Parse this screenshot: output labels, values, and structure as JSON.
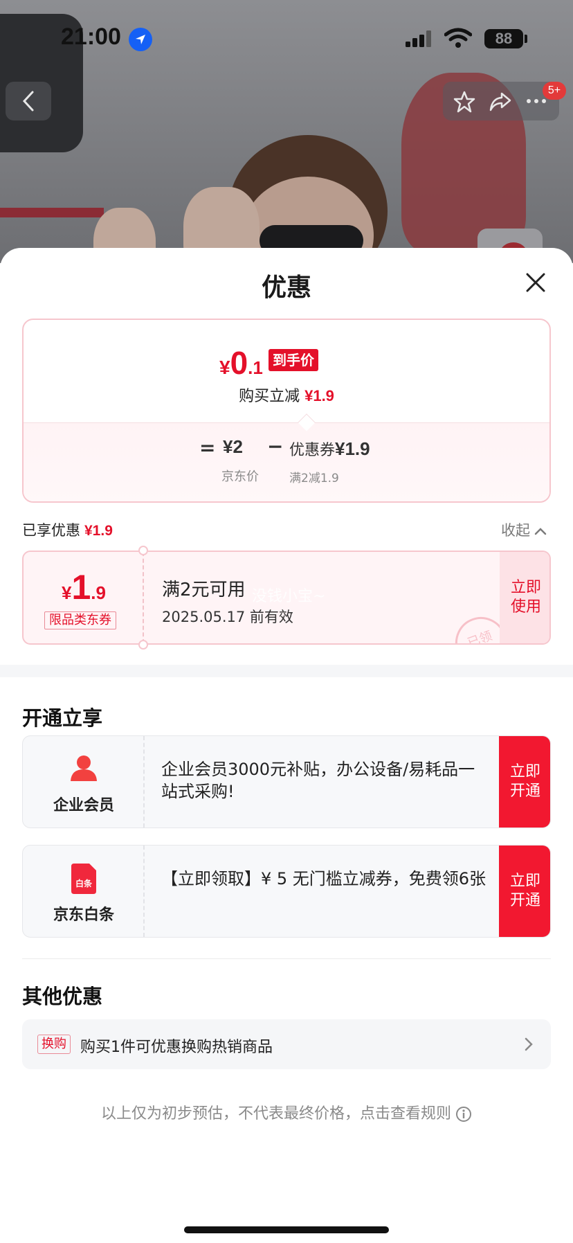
{
  "status_bar": {
    "time": "21:00",
    "battery": "88"
  },
  "top_nav": {
    "badge": "5+"
  },
  "sheet": {
    "title": "优惠",
    "summary": {
      "currency": "¥",
      "final_price_int": "0",
      "final_price_dec": ".1",
      "final_price_tag": "到手价",
      "reduce_label": "购买立减",
      "reduce_amount": "¥1.9",
      "equals": "=",
      "jd_price": "¥2",
      "jd_price_label": "京东价",
      "minus": "−",
      "coupon_label": "优惠券",
      "coupon_amount": "¥1.9",
      "coupon_condition": "满2减1.9"
    },
    "enjoyed": {
      "label": "已享优惠",
      "amount": "¥1.9",
      "collapse_label": "收起"
    },
    "coupon": {
      "currency": "¥",
      "amount_int": "1",
      "amount_dec": ".9",
      "tag": "限品类东券",
      "condition": "满2元可用",
      "validity": "2025.05.17 前有效",
      "use_button": "立即使用",
      "stamp": "已领",
      "watermark": "没钱小宝~"
    },
    "open_section": {
      "title": "开通立享",
      "items": [
        {
          "name": "企业会员",
          "desc": " 企业会员3000元补贴，办公设备/易耗品一站式采购!",
          "button": "立即开通",
          "icon": "person-icon"
        },
        {
          "name": "京东白条",
          "icon_text": "白条",
          "desc": "【立即领取】¥ 5 无门槛立减券，免费领6张",
          "button": "立即开通",
          "icon": "baitiao-icon"
        }
      ]
    },
    "other_section": {
      "title": "其他优惠",
      "tag": "换购",
      "text": "购买1件可优惠换购热销商品"
    },
    "disclaimer": "以上仅为初步预估，不代表最终价格，点击查看规则"
  },
  "colors": {
    "accent_red": "#e4102a",
    "button_red": "#f21830",
    "pink_bg": "#fff4f6"
  }
}
